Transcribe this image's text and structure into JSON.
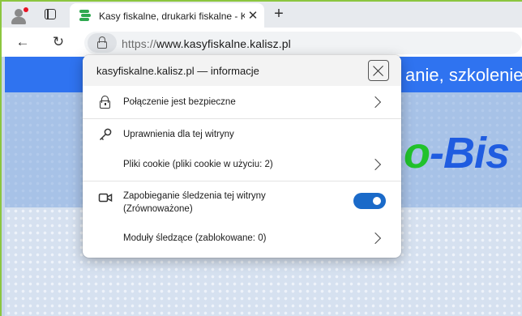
{
  "browser": {
    "tab": {
      "title": "Kasy fiskalne, drukarki fiskalne - K",
      "close_glyph": "✕"
    },
    "new_tab_glyph": "+",
    "back_glyph": "←",
    "reload_glyph": "↻",
    "address": {
      "protocol": "https://",
      "host": "www.kasyfiskalne.kalisz.pl"
    }
  },
  "page": {
    "banner_text": "anie, szkolenie, fi",
    "logo_green": "o",
    "logo_blue": "-Bis"
  },
  "site_info_popup": {
    "title": "kasyfiskalne.kalisz.pl — informacje",
    "rows": [
      {
        "icon": "lock-icon",
        "label": "Połączenie jest bezpieczne"
      },
      {
        "icon": "key-icon",
        "label": "Uprawnienia dla tej witryny"
      },
      {
        "icon": "",
        "label": "Pliki cookie (pliki cookie w użyciu: 2)"
      },
      {
        "icon": "camera-icon",
        "label": "Zapobieganie śledzenia tej witryny",
        "label_line2": "(Zrównoważone)",
        "toggle_on": true
      },
      {
        "icon": "",
        "label": "Moduły śledzące (zablokowane: 0)"
      }
    ]
  },
  "colors": {
    "accent": "#1a6ac9",
    "window_border": "#8cc63f",
    "banner": "#2f73f0"
  }
}
